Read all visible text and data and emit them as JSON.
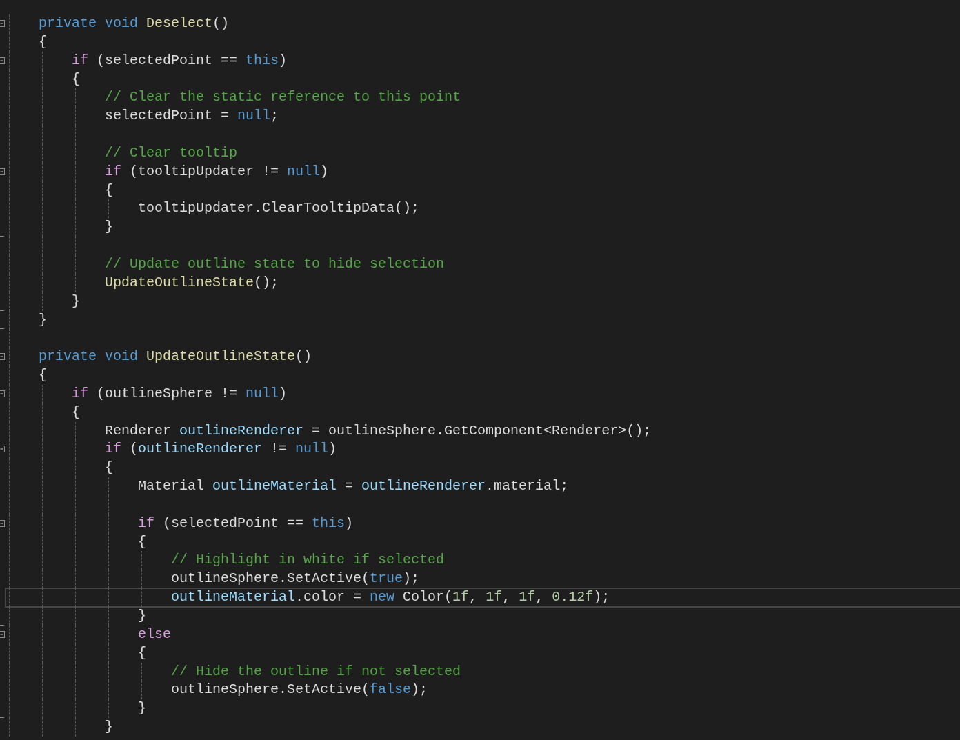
{
  "editor": {
    "lines": [
      {
        "collapsible": true,
        "block_end": false,
        "current": false,
        "tokens": [
          {
            "text": "private void ",
            "kind": "keyword"
          },
          {
            "text": "Deselect",
            "kind": "method"
          },
          {
            "text": "()",
            "kind": "plain"
          }
        ]
      },
      {
        "collapsible": false,
        "block_end": false,
        "current": false,
        "tokens": [
          {
            "text": "{",
            "kind": "plain"
          }
        ],
        "children": [
          {
            "collapsible": true,
            "block_end": false,
            "current": false,
            "tokens": [
              {
                "text": "if",
                "kind": "control"
              },
              {
                "text": " (selectedPoint == ",
                "kind": "plain"
              },
              {
                "text": "this",
                "kind": "keyword"
              },
              {
                "text": ")",
                "kind": "plain"
              }
            ]
          },
          {
            "collapsible": false,
            "block_end": false,
            "current": false,
            "tokens": [
              {
                "text": "{",
                "kind": "plain"
              }
            ],
            "children": [
              {
                "collapsible": false,
                "block_end": false,
                "current": false,
                "tokens": [
                  {
                    "text": "// Clear the static reference to this point",
                    "kind": "comment"
                  }
                ]
              },
              {
                "collapsible": false,
                "block_end": false,
                "current": false,
                "tokens": [
                  {
                    "text": "selectedPoint = ",
                    "kind": "plain"
                  },
                  {
                    "text": "null",
                    "kind": "keyword"
                  },
                  {
                    "text": ";",
                    "kind": "plain"
                  }
                ]
              },
              {
                "collapsible": false,
                "block_end": false,
                "current": false
              },
              {
                "collapsible": false,
                "block_end": false,
                "current": false,
                "tokens": [
                  {
                    "text": "// Clear tooltip",
                    "kind": "comment"
                  }
                ]
              },
              {
                "collapsible": true,
                "block_end": false,
                "current": false,
                "tokens": [
                  {
                    "text": "if",
                    "kind": "control"
                  },
                  {
                    "text": " (tooltipUpdater != ",
                    "kind": "plain"
                  },
                  {
                    "text": "null",
                    "kind": "keyword"
                  },
                  {
                    "text": ")",
                    "kind": "plain"
                  }
                ]
              },
              {
                "collapsible": false,
                "block_end": false,
                "current": false,
                "tokens": [
                  {
                    "text": "{",
                    "kind": "plain"
                  }
                ],
                "children": [
                  {
                    "collapsible": false,
                    "block_end": false,
                    "current": false,
                    "tokens": [
                      {
                        "text": "tooltipUpdater.ClearTooltipData();",
                        "kind": "plain"
                      }
                    ]
                  }
                ]
              },
              {
                "collapsible": false,
                "block_end": true,
                "current": false,
                "tokens": [
                  {
                    "text": "}",
                    "kind": "plain"
                  }
                ]
              },
              {
                "collapsible": false,
                "block_end": false,
                "current": false
              },
              {
                "collapsible": false,
                "block_end": false,
                "current": false,
                "tokens": [
                  {
                    "text": "// Update outline state to hide selection",
                    "kind": "comment"
                  }
                ]
              },
              {
                "collapsible": false,
                "block_end": false,
                "current": false,
                "tokens": [
                  {
                    "text": "UpdateOutlineState",
                    "kind": "method"
                  },
                  {
                    "text": "();",
                    "kind": "plain"
                  }
                ]
              }
            ]
          },
          {
            "collapsible": false,
            "block_end": true,
            "current": false,
            "tokens": [
              {
                "text": "}",
                "kind": "plain"
              }
            ]
          }
        ]
      },
      {
        "collapsible": false,
        "block_end": true,
        "current": false,
        "tokens": [
          {
            "text": "}",
            "kind": "plain"
          }
        ]
      },
      {
        "collapsible": false,
        "block_end": false,
        "current": false
      },
      {
        "collapsible": true,
        "block_end": false,
        "current": false,
        "tokens": [
          {
            "text": "private void ",
            "kind": "keyword"
          },
          {
            "text": "UpdateOutlineState",
            "kind": "method"
          },
          {
            "text": "()",
            "kind": "plain"
          }
        ]
      },
      {
        "collapsible": false,
        "block_end": false,
        "current": false,
        "tokens": [
          {
            "text": "{",
            "kind": "plain"
          }
        ],
        "children": [
          {
            "collapsible": true,
            "block_end": false,
            "current": false,
            "tokens": [
              {
                "text": "if",
                "kind": "control"
              },
              {
                "text": " (outlineSphere != ",
                "kind": "plain"
              },
              {
                "text": "null",
                "kind": "keyword"
              },
              {
                "text": ")",
                "kind": "plain"
              }
            ]
          },
          {
            "collapsible": false,
            "block_end": false,
            "current": false,
            "tokens": [
              {
                "text": "{",
                "kind": "plain"
              }
            ],
            "children": [
              {
                "collapsible": false,
                "block_end": false,
                "current": false,
                "tokens": [
                  {
                    "text": "Renderer ",
                    "kind": "plain"
                  },
                  {
                    "text": "outlineRenderer",
                    "kind": "local"
                  },
                  {
                    "text": " = outlineSphere.GetComponent<Renderer>();",
                    "kind": "plain"
                  }
                ]
              },
              {
                "collapsible": true,
                "block_end": false,
                "current": false,
                "tokens": [
                  {
                    "text": "if",
                    "kind": "control"
                  },
                  {
                    "text": " (",
                    "kind": "plain"
                  },
                  {
                    "text": "outlineRenderer",
                    "kind": "local"
                  },
                  {
                    "text": " != ",
                    "kind": "plain"
                  },
                  {
                    "text": "null",
                    "kind": "keyword"
                  },
                  {
                    "text": ")",
                    "kind": "plain"
                  }
                ]
              },
              {
                "collapsible": false,
                "block_end": false,
                "current": false,
                "tokens": [
                  {
                    "text": "{",
                    "kind": "plain"
                  }
                ],
                "children": [
                  {
                    "collapsible": false,
                    "block_end": false,
                    "current": false,
                    "tokens": [
                      {
                        "text": "Material ",
                        "kind": "plain"
                      },
                      {
                        "text": "outlineMaterial",
                        "kind": "local"
                      },
                      {
                        "text": " = ",
                        "kind": "plain"
                      },
                      {
                        "text": "outlineRenderer",
                        "kind": "local"
                      },
                      {
                        "text": ".material;",
                        "kind": "plain"
                      }
                    ]
                  },
                  {
                    "collapsible": false,
                    "block_end": false,
                    "current": false
                  },
                  {
                    "collapsible": true,
                    "block_end": false,
                    "current": false,
                    "tokens": [
                      {
                        "text": "if",
                        "kind": "control"
                      },
                      {
                        "text": " (selectedPoint == ",
                        "kind": "plain"
                      },
                      {
                        "text": "this",
                        "kind": "keyword"
                      },
                      {
                        "text": ")",
                        "kind": "plain"
                      }
                    ]
                  },
                  {
                    "collapsible": false,
                    "block_end": false,
                    "current": false,
                    "tokens": [
                      {
                        "text": "{",
                        "kind": "plain"
                      }
                    ],
                    "children": [
                      {
                        "collapsible": false,
                        "block_end": false,
                        "current": false,
                        "tokens": [
                          {
                            "text": "// Highlight in white if selected",
                            "kind": "comment"
                          }
                        ]
                      },
                      {
                        "collapsible": false,
                        "block_end": false,
                        "current": false,
                        "tokens": [
                          {
                            "text": "outlineSphere.SetActive(",
                            "kind": "plain"
                          },
                          {
                            "text": "true",
                            "kind": "keyword"
                          },
                          {
                            "text": ");",
                            "kind": "plain"
                          }
                        ]
                      },
                      {
                        "collapsible": false,
                        "block_end": false,
                        "current": true,
                        "tokens": [
                          {
                            "text": "outlineMaterial",
                            "kind": "local"
                          },
                          {
                            "text": ".color = ",
                            "kind": "plain"
                          },
                          {
                            "text": "new",
                            "kind": "keyword"
                          },
                          {
                            "text": " Color(",
                            "kind": "plain"
                          },
                          {
                            "text": "1f",
                            "kind": "number"
                          },
                          {
                            "text": ", ",
                            "kind": "plain"
                          },
                          {
                            "text": "1f",
                            "kind": "number"
                          },
                          {
                            "text": ", ",
                            "kind": "plain"
                          },
                          {
                            "text": "1f",
                            "kind": "number"
                          },
                          {
                            "text": ", ",
                            "kind": "plain"
                          },
                          {
                            "text": "0.12f",
                            "kind": "number"
                          },
                          {
                            "text": ");",
                            "kind": "plain"
                          }
                        ]
                      }
                    ]
                  },
                  {
                    "collapsible": false,
                    "block_end": true,
                    "current": false,
                    "tokens": [
                      {
                        "text": "}",
                        "kind": "plain"
                      }
                    ]
                  },
                  {
                    "collapsible": true,
                    "block_end": false,
                    "current": false,
                    "tokens": [
                      {
                        "text": "else",
                        "kind": "control"
                      }
                    ]
                  },
                  {
                    "collapsible": false,
                    "block_end": false,
                    "current": false,
                    "tokens": [
                      {
                        "text": "{",
                        "kind": "plain"
                      }
                    ],
                    "children": [
                      {
                        "collapsible": false,
                        "block_end": false,
                        "current": false,
                        "tokens": [
                          {
                            "text": "// Hide the outline if not selected",
                            "kind": "comment"
                          }
                        ]
                      },
                      {
                        "collapsible": false,
                        "block_end": false,
                        "current": false,
                        "tokens": [
                          {
                            "text": "outlineSphere.SetActive(",
                            "kind": "plain"
                          },
                          {
                            "text": "false",
                            "kind": "keyword"
                          },
                          {
                            "text": ");",
                            "kind": "plain"
                          }
                        ]
                      }
                    ]
                  },
                  {
                    "collapsible": false,
                    "block_end": true,
                    "current": false,
                    "tokens": [
                      {
                        "text": "}",
                        "kind": "plain"
                      }
                    ]
                  }
                ]
              },
              {
                "collapsible": false,
                "block_end": false,
                "current": false,
                "tokens": [
                  {
                    "text": "}",
                    "kind": "plain"
                  }
                ]
              }
            ]
          }
        ]
      }
    ]
  }
}
